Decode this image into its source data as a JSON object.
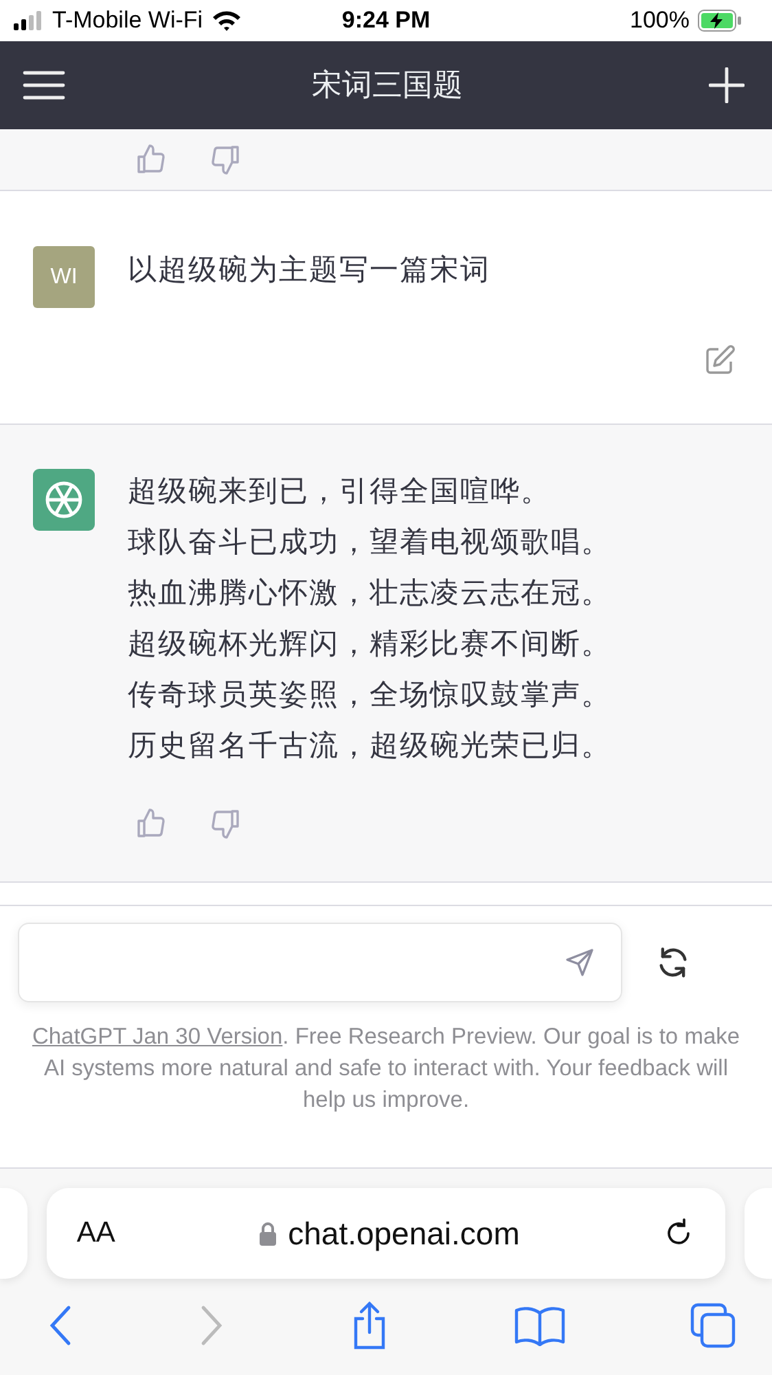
{
  "status_bar": {
    "carrier": "T-Mobile Wi-Fi",
    "time": "9:24 PM",
    "battery": "100%"
  },
  "header": {
    "title": "宋词三国题"
  },
  "messages": [
    {
      "kind": "feedback"
    },
    {
      "kind": "prompt",
      "avatar": "WI",
      "lines": [
        "以超级碗为主题写一篇宋词"
      ]
    },
    {
      "kind": "reply",
      "lines": [
        "超级碗来到已，引得全国喧哗。",
        "球队奋斗已成功，望着电视颂歌唱。",
        "热血沸腾心怀激，壮志凌云志在冠。",
        "超级碗杯光辉闪，精彩比赛不间断。",
        "传奇球员英姿照，全场惊叹鼓掌声。",
        "历史留名千古流，超级碗光荣已归。"
      ]
    }
  ],
  "footer": {
    "link": "ChatGPT Jan 30 Version",
    "text": ". Free Research Preview. Our goal is to make AI systems more natural and safe to interact with. Your feedback will help us improve."
  },
  "browser": {
    "text_size": "AA",
    "url": "chat.openai.com",
    "nav": [
      {
        "kind": "back",
        "disabled": false
      },
      {
        "kind": "forward",
        "disabled": true
      },
      {
        "kind": "share",
        "disabled": false
      },
      {
        "kind": "bookmarks",
        "disabled": false
      },
      {
        "kind": "tabs",
        "disabled": false
      }
    ]
  }
}
